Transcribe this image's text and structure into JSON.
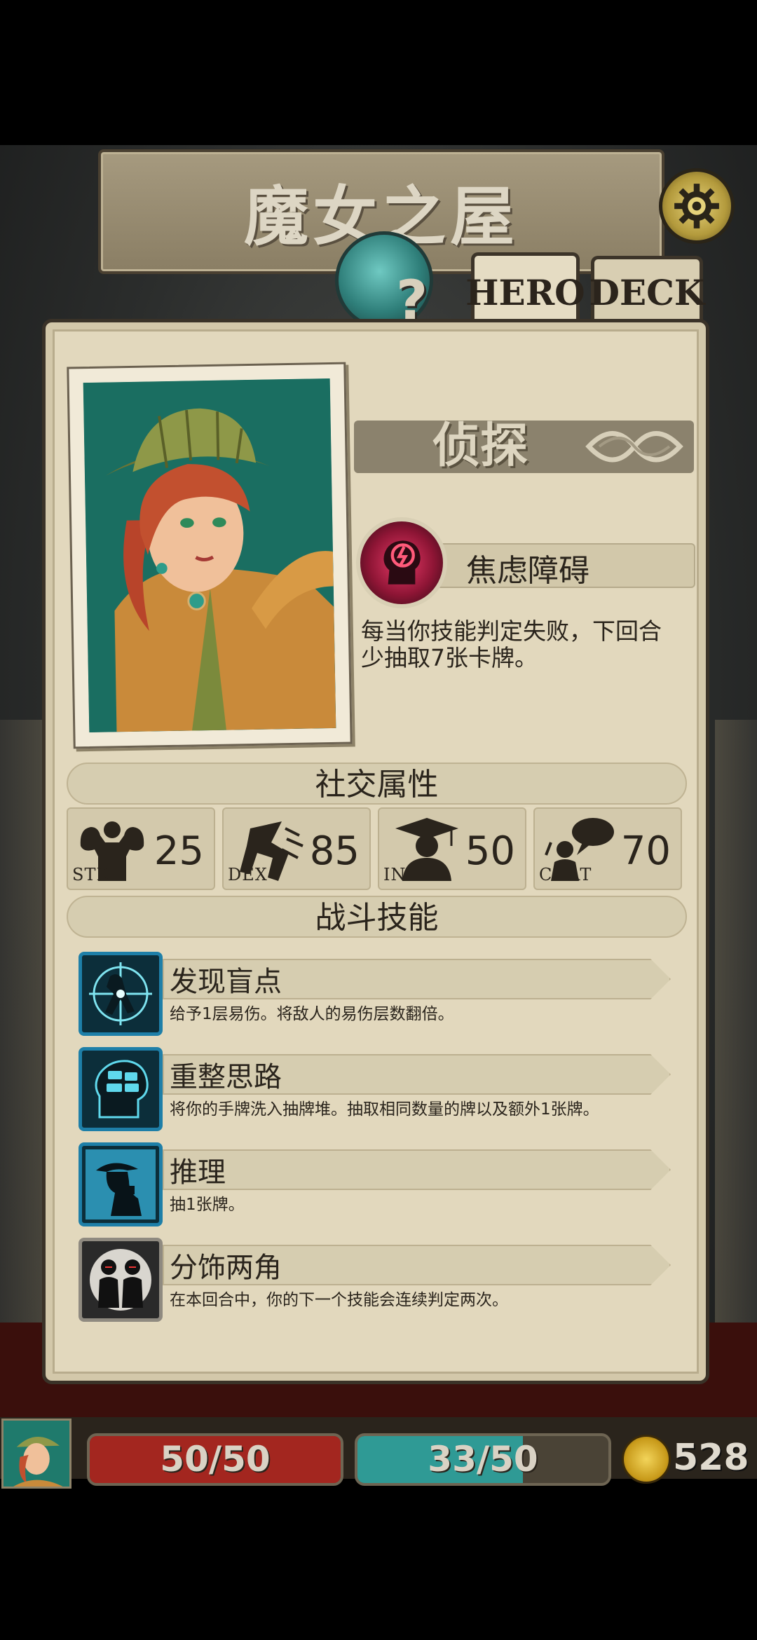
{
  "header": {
    "title": "魔女之屋",
    "settings_icon": "gear-icon",
    "unknown_mark": "?"
  },
  "tabs": [
    {
      "label": "HERO",
      "selected": true
    },
    {
      "label": "DECK",
      "selected": false
    }
  ],
  "hero": {
    "class_name": "侦探",
    "trait": {
      "name": "焦虑障碍",
      "icon": "anxious-head-icon",
      "description": "每当你技能判定失败，下回合少抽取7张卡牌。"
    }
  },
  "social": {
    "header": "社交属性",
    "stats": [
      {
        "label": "STR",
        "value": "25",
        "icon": "muscle-icon"
      },
      {
        "label": "DEX",
        "value": "85",
        "icon": "running-icon"
      },
      {
        "label": "INT",
        "value": "50",
        "icon": "scholar-icon"
      },
      {
        "label": "CHAT",
        "value": "70",
        "icon": "speech-icon"
      }
    ]
  },
  "combat": {
    "header": "战斗技能",
    "skills": [
      {
        "name": "发现盲点",
        "description": "给予1层易伤。将敌人的易伤层数翻倍。",
        "icon": "crosshair-figure-icon"
      },
      {
        "name": "重整思路",
        "description": "将你的手牌洗入抽牌堆。抽取相同数量的牌以及额外1张牌。",
        "icon": "brain-cards-icon"
      },
      {
        "name": "推理",
        "description": "抽1张牌。",
        "icon": "detective-silhouette-icon"
      },
      {
        "name": "分饰两角",
        "description": "在本回合中，你的下一个技能会连续判定两次。",
        "icon": "twin-figures-icon"
      }
    ]
  },
  "hud": {
    "health": "50/50",
    "health_fraction": 1.0,
    "sanity": "33/50",
    "sanity_fraction": 0.66,
    "gold": "528",
    "colors": {
      "health": "#a3261f",
      "sanity": "#2f9a95"
    }
  }
}
